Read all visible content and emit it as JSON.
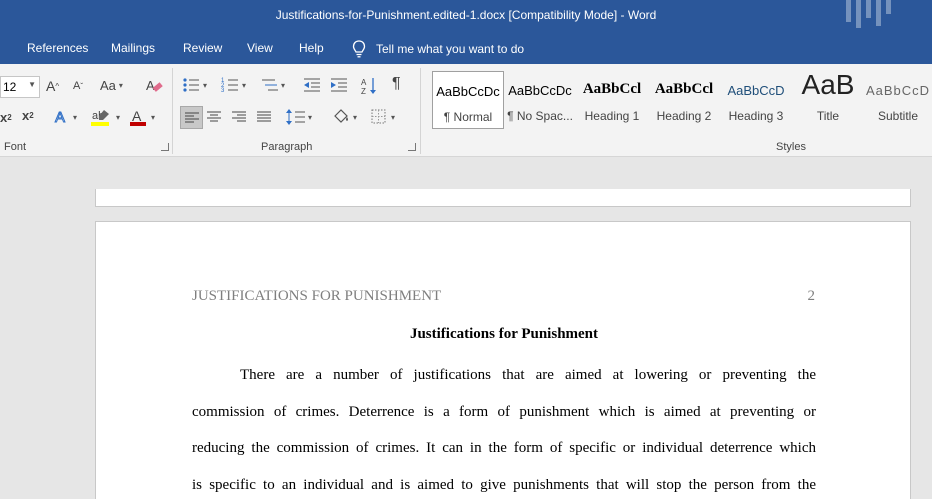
{
  "window": {
    "title": "Justifications-for-Punishment.edited-1.docx [Compatibility Mode]  -  Word"
  },
  "menu": {
    "tabs": [
      "References",
      "Mailings",
      "Review",
      "View",
      "Help"
    ],
    "tell_me": "Tell me what you want to do"
  },
  "ribbon": {
    "font": {
      "size": "12",
      "grow_label": "A",
      "shrink_label": "A",
      "case_label": "Aa",
      "subscript_label": "x",
      "superscript_label": "x",
      "group_label": "Font",
      "highlight_color": "#ffff00",
      "font_color": "#c00000"
    },
    "paragraph": {
      "group_label": "Paragraph"
    },
    "styles": {
      "group_label": "Styles",
      "items": [
        {
          "sample": "AaBbCcDc",
          "name": "¶ Normal",
          "selected": true
        },
        {
          "sample": "AaBbCcDc",
          "name": "¶ No Spac..."
        },
        {
          "sample": "AaBbCcl",
          "name": "Heading 1"
        },
        {
          "sample": "AaBbCcl",
          "name": "Heading 2"
        },
        {
          "sample": "AaBbCcD",
          "name": "Heading 3"
        },
        {
          "sample": "AaB",
          "name": "Title"
        },
        {
          "sample": "AaBbCcD",
          "name": "Subtitle"
        }
      ]
    }
  },
  "document": {
    "running_header": "JUSTIFICATIONS FOR PUNISHMENT",
    "page_number": "2",
    "title": "Justifications for Punishment",
    "lines": [
      "There are a number of justifications that are aimed at lowering or preventing the",
      "commission of crimes. Deterrence is a form of punishment which is aimed at preventing or",
      "reducing the commission of crimes. It can in the form of specific or individual deterrence which",
      "is specific to an individual and is aimed to give punishments that will stop the person from the"
    ]
  },
  "colors": {
    "accent": "#2b579a",
    "ribbon_bg": "#f3f3f3",
    "canvas_bg": "#e6e6e6"
  }
}
